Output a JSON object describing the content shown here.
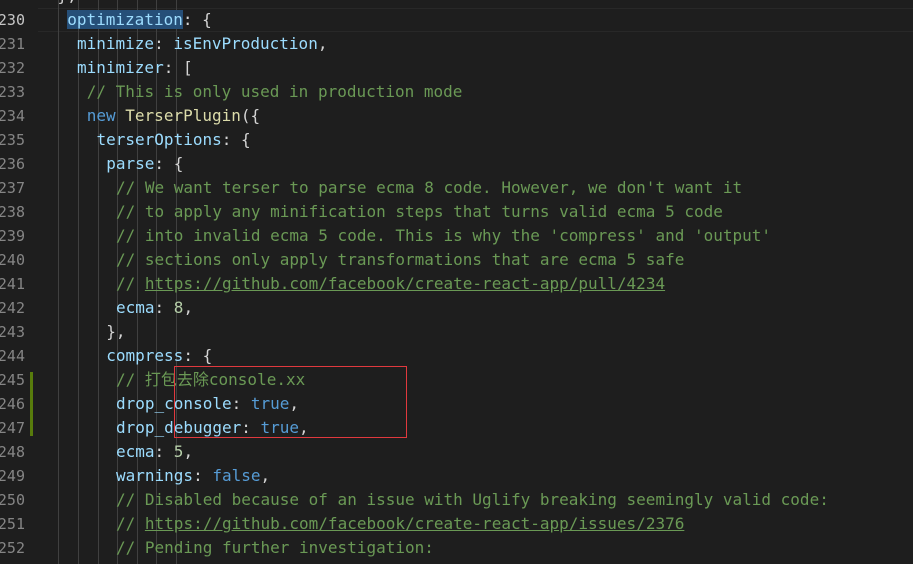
{
  "lines": [
    {
      "num": "",
      "tokens": [
        {
          "t": "},",
          "c": "txt"
        }
      ]
    },
    {
      "num": "230",
      "active": true,
      "tokens": [
        {
          "t": "optimization",
          "c": "p hl"
        },
        {
          "t": ": {",
          "c": "txt"
        }
      ]
    },
    {
      "num": "231",
      "tokens": [
        {
          "t": "minimize",
          "c": "p"
        },
        {
          "t": ": ",
          "c": "txt"
        },
        {
          "t": "isEnvProduction",
          "c": "p"
        },
        {
          "t": ",",
          "c": "txt"
        }
      ]
    },
    {
      "num": "232",
      "tokens": [
        {
          "t": "minimizer",
          "c": "p"
        },
        {
          "t": ": [",
          "c": "txt"
        }
      ]
    },
    {
      "num": "233",
      "tokens": [
        {
          "t": "// This is only used in production mode",
          "c": "c"
        }
      ]
    },
    {
      "num": "234",
      "tokens": [
        {
          "t": "new ",
          "c": "k"
        },
        {
          "t": "TerserPlugin",
          "c": "f"
        },
        {
          "t": "({",
          "c": "txt"
        }
      ]
    },
    {
      "num": "235",
      "tokens": [
        {
          "t": "terserOptions",
          "c": "p"
        },
        {
          "t": ": {",
          "c": "txt"
        }
      ]
    },
    {
      "num": "236",
      "tokens": [
        {
          "t": "parse",
          "c": "p"
        },
        {
          "t": ": {",
          "c": "txt"
        }
      ]
    },
    {
      "num": "237",
      "tokens": [
        {
          "t": "// We want terser to parse ecma 8 code. However, we don't want it",
          "c": "c"
        }
      ]
    },
    {
      "num": "238",
      "tokens": [
        {
          "t": "// to apply any minification steps that turns valid ecma 5 code",
          "c": "c"
        }
      ]
    },
    {
      "num": "239",
      "tokens": [
        {
          "t": "// into invalid ecma 5 code. This is why the 'compress' and 'output'",
          "c": "c"
        }
      ]
    },
    {
      "num": "240",
      "tokens": [
        {
          "t": "// sections only apply transformations that are ecma 5 safe",
          "c": "c"
        }
      ]
    },
    {
      "num": "241",
      "tokens": [
        {
          "t": "// ",
          "c": "c"
        },
        {
          "t": "https://github.com/facebook/create-react-app/pull/4234",
          "c": "c u"
        }
      ]
    },
    {
      "num": "242",
      "tokens": [
        {
          "t": "ecma",
          "c": "p"
        },
        {
          "t": ": ",
          "c": "txt"
        },
        {
          "t": "8",
          "c": "n"
        },
        {
          "t": ",",
          "c": "txt"
        }
      ]
    },
    {
      "num": "243",
      "tokens": [
        {
          "t": "},",
          "c": "txt"
        }
      ]
    },
    {
      "num": "244",
      "tokens": [
        {
          "t": "compress",
          "c": "p"
        },
        {
          "t": ": {",
          "c": "txt"
        }
      ]
    },
    {
      "num": "245",
      "tokens": [
        {
          "t": "// 打包去除console.xx",
          "c": "c"
        }
      ]
    },
    {
      "num": "246",
      "tokens": [
        {
          "t": "drop_console",
          "c": "p"
        },
        {
          "t": ": ",
          "c": "txt"
        },
        {
          "t": "true",
          "c": "k"
        },
        {
          "t": ",",
          "c": "txt"
        }
      ]
    },
    {
      "num": "247",
      "tokens": [
        {
          "t": "drop_debugger",
          "c": "p"
        },
        {
          "t": ": ",
          "c": "txt"
        },
        {
          "t": "true",
          "c": "k"
        },
        {
          "t": ",",
          "c": "txt"
        }
      ]
    },
    {
      "num": "248",
      "tokens": [
        {
          "t": "ecma",
          "c": "p"
        },
        {
          "t": ": ",
          "c": "txt"
        },
        {
          "t": "5",
          "c": "n"
        },
        {
          "t": ",",
          "c": "txt"
        }
      ]
    },
    {
      "num": "249",
      "tokens": [
        {
          "t": "warnings",
          "c": "p"
        },
        {
          "t": ": ",
          "c": "txt"
        },
        {
          "t": "false",
          "c": "k"
        },
        {
          "t": ",",
          "c": "txt"
        }
      ]
    },
    {
      "num": "250",
      "tokens": [
        {
          "t": "// Disabled because of an issue with Uglify breaking seemingly valid code:",
          "c": "c"
        }
      ]
    },
    {
      "num": "251",
      "tokens": [
        {
          "t": "// ",
          "c": "c"
        },
        {
          "t": "https://github.com/facebook/create-react-app/issues/2376",
          "c": "c u"
        }
      ]
    },
    {
      "num": "252",
      "tokens": [
        {
          "t": "// Pending further investigation:",
          "c": "c"
        }
      ]
    }
  ],
  "colors": {
    "background": "#1e1e1e",
    "keyword": "#569cd6",
    "property": "#9cdcfe",
    "function": "#dcdcaa",
    "comment": "#6a9955",
    "number": "#b5cea8",
    "highlight_box": "#e0393e",
    "modified_gutter": "#587c0c"
  }
}
